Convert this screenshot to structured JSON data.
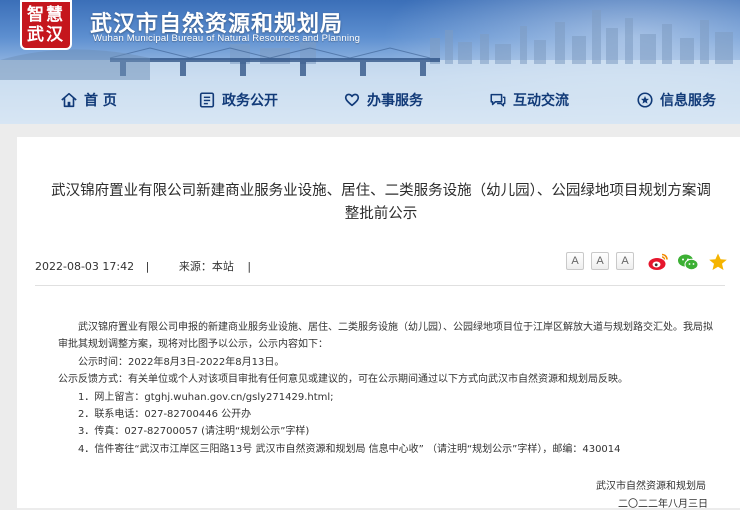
{
  "header": {
    "logo_line1": "智慧",
    "logo_line2": "武汉",
    "title": "武汉市自然资源和规划局",
    "subtitle": "Wuhan Municipal Bureau of Natural Resources and Planning"
  },
  "nav": {
    "items": [
      {
        "label": "首 页",
        "icon": "home-icon"
      },
      {
        "label": "政务公开",
        "icon": "document-icon"
      },
      {
        "label": "办事服务",
        "icon": "heart-hand-icon"
      },
      {
        "label": "互动交流",
        "icon": "chat-icon"
      },
      {
        "label": "信息服务",
        "icon": "info-icon"
      }
    ]
  },
  "article": {
    "title": "武汉锦府置业有限公司新建商业服务业设施、居住、二类服务设施（幼儿园）、公园绿地项目规划方案调整批前公示",
    "date": "2022-08-03 17:42",
    "separator": "|",
    "source": "来源：本站",
    "font_sizes": [
      "A",
      "A",
      "A"
    ],
    "share_icons": [
      "weibo-icon",
      "wechat-icon",
      "favorite-star-icon"
    ],
    "paragraphs": [
      "武汉锦府置业有限公司申报的新建商业服务业设施、居住、二类服务设施（幼儿园）、公园绿地项目位于江岸区解放大道与规划路交汇处。我局拟审批其规划调整方案，现将对比图予以公示，公示内容如下：",
      "公示时间：2022年8月3日-2022年8月13日。",
      "公示反馈方式：有关单位或个人对该项目审批有任何意见或建议的，可在公示期间通过以下方式向武汉市自然资源和规划局反映。",
      "1．网上留言：gtghj.wuhan.gov.cn/gsly271429.html;",
      "2．联系电话：027-82700446    公开办",
      "3．传真：027-82700057 (请注明“规划公示”字样)",
      "4．信件寄往“武汉市江岸区三阳路13号 武汉市自然资源和规划局 信息中心收” （请注明“规划公示”字样），邮编：430014"
    ],
    "signature": "武汉市自然资源和规划局",
    "sign_date": "二〇二二年八月三日"
  },
  "colors": {
    "nav_text": "#113a78",
    "logo_red": "#c5161d",
    "weibo": "#e6162d",
    "wechat": "#3cb034",
    "star": "#f5b400"
  }
}
